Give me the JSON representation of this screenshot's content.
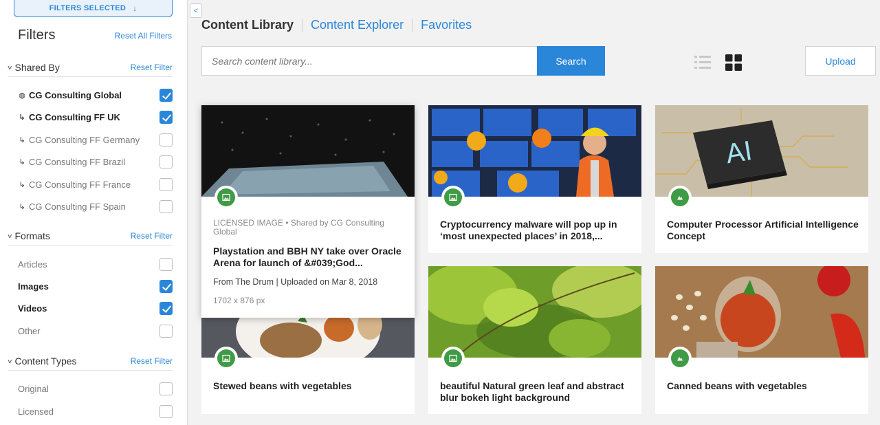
{
  "sidebar": {
    "filters_selected": "FILTERS SELECTED",
    "title": "Filters",
    "reset_all": "Reset All Filters",
    "groups": {
      "shared_by": {
        "label": "Shared By",
        "reset": "Reset Filter",
        "items": [
          {
            "label": "CG Consulting Global",
            "checked": true,
            "icon": "globe-icon"
          },
          {
            "label": "CG Consulting FF UK",
            "checked": true,
            "icon": "child-arrow-icon"
          },
          {
            "label": "CG Consulting FF Germany",
            "checked": false,
            "icon": "child-arrow-icon"
          },
          {
            "label": "CG Consulting FF Brazil",
            "checked": false,
            "icon": "child-arrow-icon"
          },
          {
            "label": "CG Consulting FF France",
            "checked": false,
            "icon": "child-arrow-icon"
          },
          {
            "label": "CG Consulting FF Spain",
            "checked": false,
            "icon": "child-arrow-icon"
          }
        ]
      },
      "formats": {
        "label": "Formats",
        "reset": "Reset Filter",
        "items": [
          {
            "label": "Articles",
            "checked": false
          },
          {
            "label": "Images",
            "checked": true
          },
          {
            "label": "Videos",
            "checked": true
          },
          {
            "label": "Other",
            "checked": false
          }
        ]
      },
      "content_types": {
        "label": "Content Types",
        "reset": "Reset Filter",
        "items": [
          {
            "label": "Original",
            "checked": false
          },
          {
            "label": "Licensed",
            "checked": false
          }
        ]
      }
    }
  },
  "header": {
    "tabs": [
      {
        "label": "Content Library",
        "active": true
      },
      {
        "label": "Content Explorer",
        "active": false
      },
      {
        "label": "Favorites",
        "active": false
      }
    ],
    "search_placeholder": "Search content library...",
    "search_label": "Search",
    "upload_label": "Upload"
  },
  "cards": [
    {
      "title": "Playstation and BBH NY take over Oracle Arena for launch of &#039;God...",
      "license_line": "LICENSED IMAGE • Shared by CG Consulting Global",
      "source_line": "From The Drum | Uploaded on Mar 8, 2018",
      "dimensions": "1702 x 876 px",
      "badge_icon": "image-icon"
    },
    {
      "title": "Cryptocurrency malware will pop up in ‘most unexpected places’ in 2018,...",
      "badge_icon": "image-icon"
    },
    {
      "title": "Computer Processor Artificial Intelligence Concept",
      "badge_icon": "image-icon"
    },
    {
      "title": "Stewed beans with vegetables",
      "badge_icon": "image-icon"
    },
    {
      "title": "beautiful Natural green leaf and abstract blur bokeh light background",
      "badge_icon": "image-icon"
    },
    {
      "title": "Canned beans with vegetables",
      "badge_icon": "image-icon"
    }
  ],
  "thumb_text": {
    "ai_chip": "AI"
  },
  "colors": {
    "accent": "#2a86d8",
    "badge_green": "#3f9b45"
  }
}
